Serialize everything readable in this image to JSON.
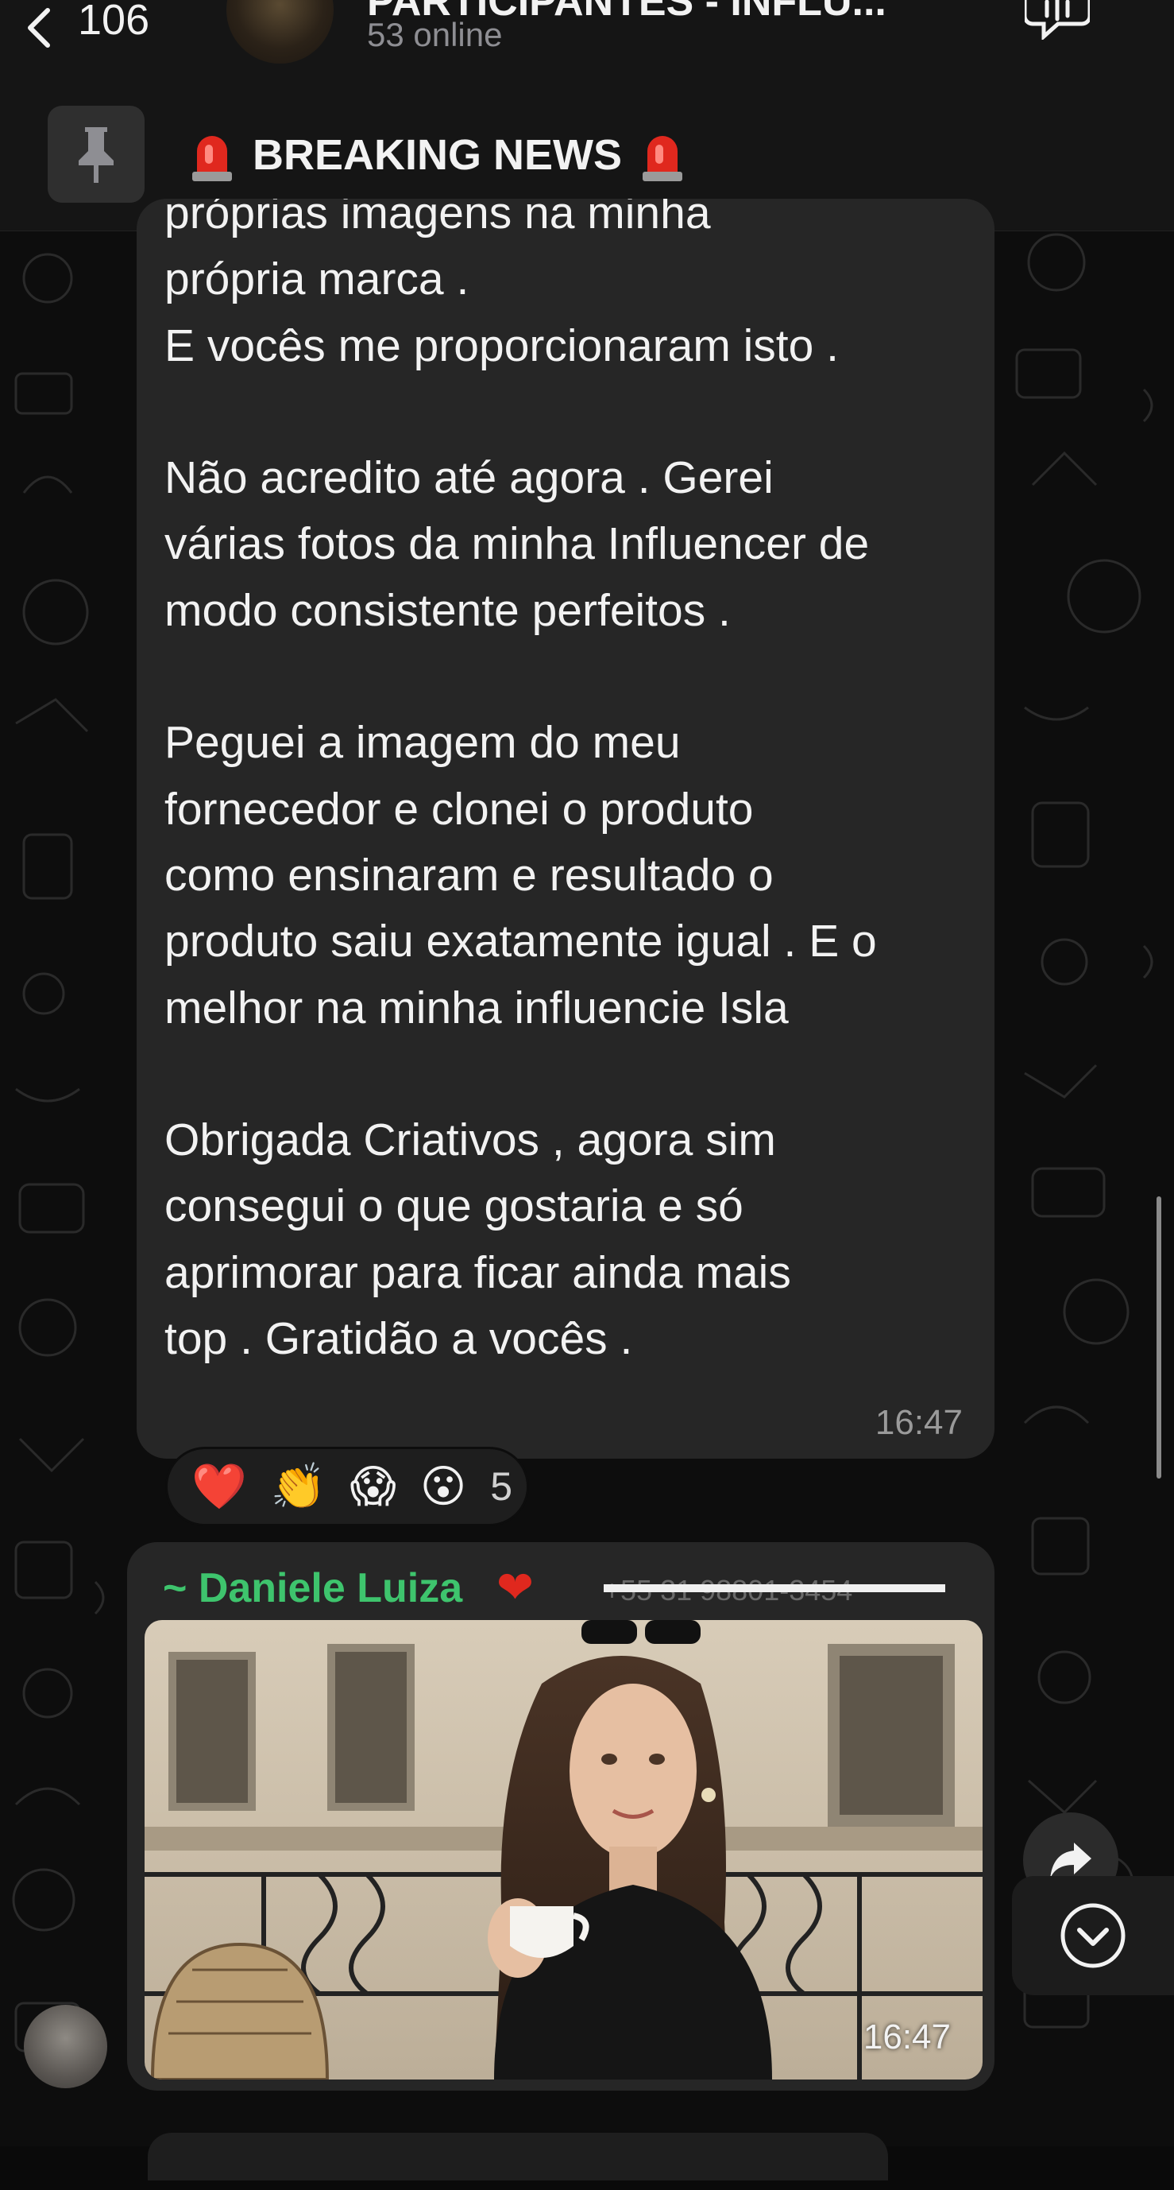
{
  "header": {
    "back_count": "106",
    "group_title": "PARTICIPANTES - INFLU...",
    "group_subtitle": "53 online"
  },
  "pinned": {
    "title": "BREAKING NEWS"
  },
  "messages": [
    {
      "text": "próprias imagens na minha\nprópria marca .\nE vocês me proporcionaram isto .\n\nNão acredito até agora . Gerei\nvárias fotos da minha Influencer de\nmodo consistente perfeitos .\n\nPeguei a imagem do meu\nfornecedor e clonei o produto\ncomo ensinaram e resultado o\nproduto saiu exatamente igual . E o\nmelhor na minha influencie Isla\n\nObrigada Criativos , agora sim\nconsegui o que gostaria e só\naprimorar para ficar ainda mais\ntop . Gratidão a vocês .",
      "time": "16:47",
      "reactions": [
        "❤️",
        "👏",
        "😱",
        "😮"
      ],
      "reaction_count": "5"
    },
    {
      "sender": "~ Daniele Luiza",
      "sender_heart": "❤",
      "phone_redacted": "+55 31 98801-3454",
      "time": "16:47"
    }
  ],
  "colors": {
    "background": "#0d0d0d",
    "bubble": "#262626",
    "sender_name": "#3ec46d",
    "timestamp": "#9a9a9a"
  },
  "icons": [
    "back-chevron-icon",
    "group-call-icon",
    "pin-icon",
    "siren-icon",
    "forward-icon",
    "scroll-down-icon"
  ]
}
